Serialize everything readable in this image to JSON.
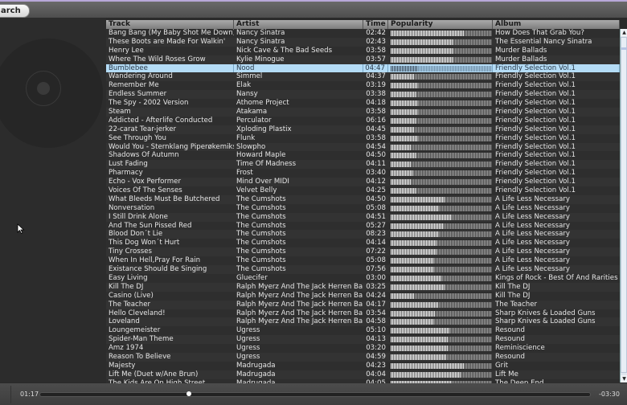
{
  "toolbar": {
    "search_label": "arch"
  },
  "left_pane": {
    "cover_icon": "cd-disc-icon"
  },
  "columns": {
    "track": "Track",
    "artist": "Artist",
    "time": "Time",
    "popularity": "Popularity",
    "album": "Album"
  },
  "selected_index": 4,
  "rows": [
    {
      "track": "Bang Bang (My Baby Shot Me Down)",
      "artist": "Nancy Sinatra",
      "time": "02:42",
      "popularity": 0.72,
      "album": "How Does That Grab You?"
    },
    {
      "track": "These Boots are Made For Walkin'",
      "artist": "Nancy Sinatra",
      "time": "02:43",
      "popularity": 0.62,
      "album": "The Essential Nancy Sinatra"
    },
    {
      "track": "Henry Lee",
      "artist": "Nick Cave & The Bad Seeds",
      "time": "03:58",
      "popularity": 0.62,
      "album": "Murder Ballads"
    },
    {
      "track": "Where The Wild Roses Grow",
      "artist": "Kylie Minogue",
      "time": "03:57",
      "popularity": 0.62,
      "album": "Murder Ballads"
    },
    {
      "track": "Bumblebee",
      "artist": "Nood",
      "time": "04:47",
      "popularity": 0.26,
      "album": "Friendly Selection Vol.1"
    },
    {
      "track": "Wandering Around",
      "artist": "Simmel",
      "time": "04:37",
      "popularity": 0.23,
      "album": "Friendly Selection Vol.1"
    },
    {
      "track": "Remember Me",
      "artist": "Elak",
      "time": "03:19",
      "popularity": 0.27,
      "album": "Friendly Selection Vol.1"
    },
    {
      "track": "Endless Summer",
      "artist": "Nansy",
      "time": "03:38",
      "popularity": 0.25,
      "album": "Friendly Selection Vol.1"
    },
    {
      "track": "The Spy - 2002 Version",
      "artist": "Athome Project",
      "time": "04:18",
      "popularity": 0.27,
      "album": "Friendly Selection Vol.1"
    },
    {
      "track": "Steam",
      "artist": "Atakama",
      "time": "03:58",
      "popularity": 0.27,
      "album": "Friendly Selection Vol.1"
    },
    {
      "track": "Addicted - Afterlife Conducted",
      "artist": "Perculator",
      "time": "06:16",
      "popularity": 0.25,
      "album": "Friendly Selection Vol.1"
    },
    {
      "track": "22-carat Tear-jerker",
      "artist": "Xploding Plastix",
      "time": "04:45",
      "popularity": 0.23,
      "album": "Friendly Selection Vol.1"
    },
    {
      "track": "See Through You",
      "artist": "Flunk",
      "time": "03:58",
      "popularity": 0.27,
      "album": "Friendly Selection Vol.1"
    },
    {
      "track": "Would You - Sternklang Piperøkemiks",
      "artist": "Slowpho",
      "time": "04:54",
      "popularity": 0.2,
      "album": "Friendly Selection Vol.1"
    },
    {
      "track": "Shadows Of Autumn",
      "artist": "Howard Maple",
      "time": "04:50",
      "popularity": 0.25,
      "album": "Friendly Selection Vol.1"
    },
    {
      "track": "Lust Fading",
      "artist": "Time Of Madness",
      "time": "04:11",
      "popularity": 0.2,
      "album": "Friendly Selection Vol.1"
    },
    {
      "track": "Pharmacy",
      "artist": "Frost",
      "time": "03:40",
      "popularity": 0.22,
      "album": "Friendly Selection Vol.1"
    },
    {
      "track": "Echo - Vox Performer",
      "artist": "Mind Over MIDI",
      "time": "04:12",
      "popularity": 0.2,
      "album": "Friendly Selection Vol.1"
    },
    {
      "track": "Voices Of The Senses",
      "artist": "Velvet Belly",
      "time": "04:25",
      "popularity": 0.25,
      "album": "Friendly Selection Vol.1"
    },
    {
      "track": "What Bleeds Must Be Butchered",
      "artist": "The Cumshots",
      "time": "04:50",
      "popularity": 0.53,
      "album": "A Life Less Necessary"
    },
    {
      "track": "Nonversation",
      "artist": "The Cumshots",
      "time": "05:08",
      "popularity": 0.48,
      "album": "A Life Less Necessary"
    },
    {
      "track": "I Still Drink Alone",
      "artist": "The Cumshots",
      "time": "04:51",
      "popularity": 0.6,
      "album": "A Life Less Necessary"
    },
    {
      "track": "And The Sun Pissed Red",
      "artist": "The Cumshots",
      "time": "05:27",
      "popularity": 0.52,
      "album": "A Life Less Necessary"
    },
    {
      "track": "Blood Don´t Lie",
      "artist": "The Cumshots",
      "time": "08:23",
      "popularity": 0.48,
      "album": "A Life Less Necessary"
    },
    {
      "track": "This Dog Won´t Hurt",
      "artist": "The Cumshots",
      "time": "04:14",
      "popularity": 0.45,
      "album": "A Life Less Necessary"
    },
    {
      "track": "Tiny Crosses",
      "artist": "The Cumshots",
      "time": "07:22",
      "popularity": 0.45,
      "album": "A Life Less Necessary"
    },
    {
      "track": "When In Hell,Pray For Rain",
      "artist": "The Cumshots",
      "time": "05:08",
      "popularity": 0.43,
      "album": "A Life Less Necessary"
    },
    {
      "track": "Existance Should Be Singing",
      "artist": "The Cumshots",
      "time": "07:56",
      "popularity": 0.43,
      "album": "A Life Less Necessary"
    },
    {
      "track": "Easy Living",
      "artist": "Gluecifer",
      "time": "03:00",
      "popularity": 0.5,
      "album": "Kings of Rock - Best Of And Rarities"
    },
    {
      "track": "Kill The DJ",
      "artist": "Ralph Myerz And The Jack Herren Band",
      "time": "03:25",
      "popularity": 0.53,
      "album": "Kill The DJ"
    },
    {
      "track": "Casino (Live)",
      "artist": "Ralph Myerz And The Jack Herren Band",
      "time": "04:24",
      "popularity": 0.23,
      "album": "Kill The DJ"
    },
    {
      "track": "The Teacher",
      "artist": "Ralph Myerz And The Jack Herren Band",
      "time": "04:17",
      "popularity": 0.47,
      "album": "The Teacher"
    },
    {
      "track": "Hello Cleveland!",
      "artist": "Ralph Myerz And The Jack Herren Band",
      "time": "03:54",
      "popularity": 0.44,
      "album": "Sharp Knives & Loaded Guns"
    },
    {
      "track": "Loveland",
      "artist": "Ralph Myerz And The Jack Herren Band",
      "time": "04:58",
      "popularity": 0.43,
      "album": "Sharp Knives & Loaded Guns"
    },
    {
      "track": "Loungemeister",
      "artist": "Ugress",
      "time": "05:10",
      "popularity": 0.58,
      "album": "Resound"
    },
    {
      "track": "Spider-Man Theme",
      "artist": "Ugress",
      "time": "04:13",
      "popularity": 0.56,
      "album": "Resound"
    },
    {
      "track": "Amz 1974",
      "artist": "Ugress",
      "time": "03:20",
      "popularity": 0.56,
      "album": "Reminiscience"
    },
    {
      "track": "Reason To Believe",
      "artist": "Ugress",
      "time": "04:59",
      "popularity": 0.55,
      "album": "Resound"
    },
    {
      "track": "Majesty",
      "artist": "Madrugada",
      "time": "04:23",
      "popularity": 0.72,
      "album": "Grit"
    },
    {
      "track": "Lift Me (Duet w/Ane Brun)",
      "artist": "Madrugada",
      "time": "04:04",
      "popularity": 0.69,
      "album": "Lift Me"
    },
    {
      "track": "The Kids Are On High Street",
      "artist": "Madrugada",
      "time": "04:05",
      "popularity": 0.6,
      "album": "The Deep End"
    }
  ],
  "player": {
    "elapsed": "01:17",
    "remaining": "-03:30",
    "progress": 0.27
  }
}
